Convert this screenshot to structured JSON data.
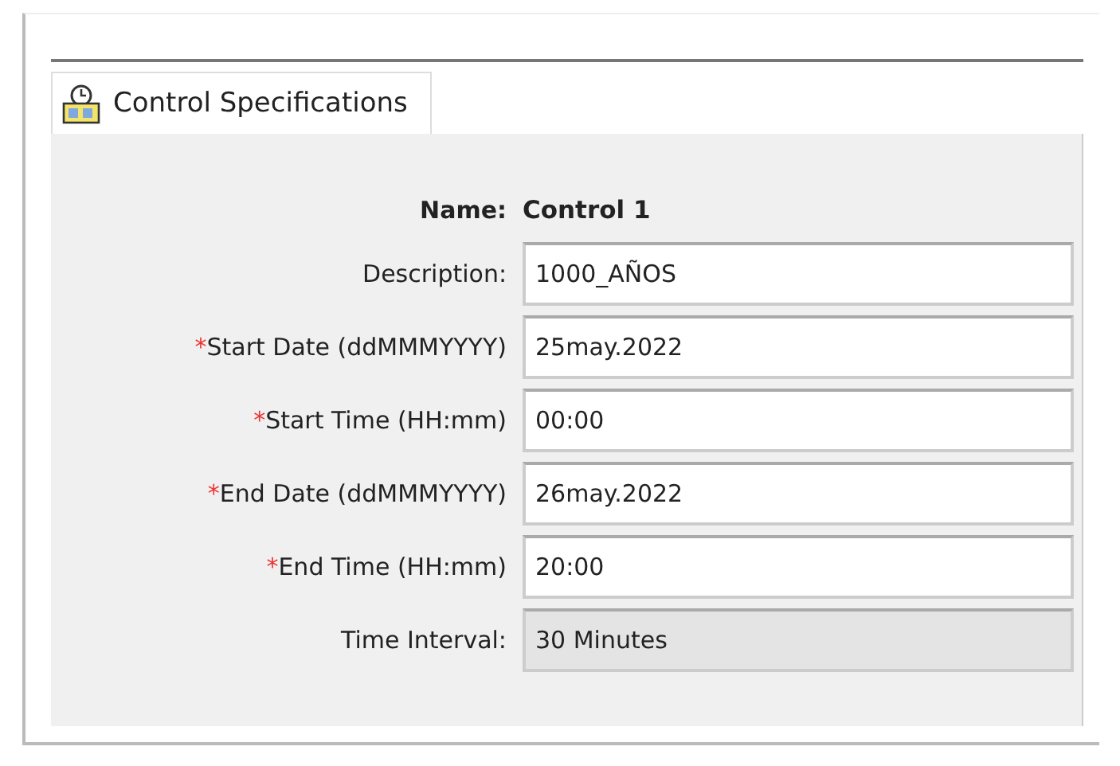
{
  "tabs": [
    {
      "label": "Control Specifications"
    }
  ],
  "fields": [
    {
      "kind": "name",
      "label": "Name:",
      "value": "Control 1"
    },
    {
      "kind": "text",
      "label": "Description:",
      "value": "1000_AÑOS"
    },
    {
      "kind": "text",
      "label": "Start Date (ddMMMYYYY)",
      "value": "25may.2022",
      "marker": "*"
    },
    {
      "kind": "text",
      "label": "Start Time (HH:mm)",
      "value": "00:00",
      "marker": "*"
    },
    {
      "kind": "text",
      "label": "End Date (ddMMMYYYY)",
      "value": "26may.2022",
      "marker": "*"
    },
    {
      "kind": "text",
      "label": "End Time (HH:mm)",
      "value": "20:00",
      "marker": "*"
    },
    {
      "kind": "disabled",
      "label": "Time Interval:",
      "value": "30 Minutes"
    }
  ]
}
